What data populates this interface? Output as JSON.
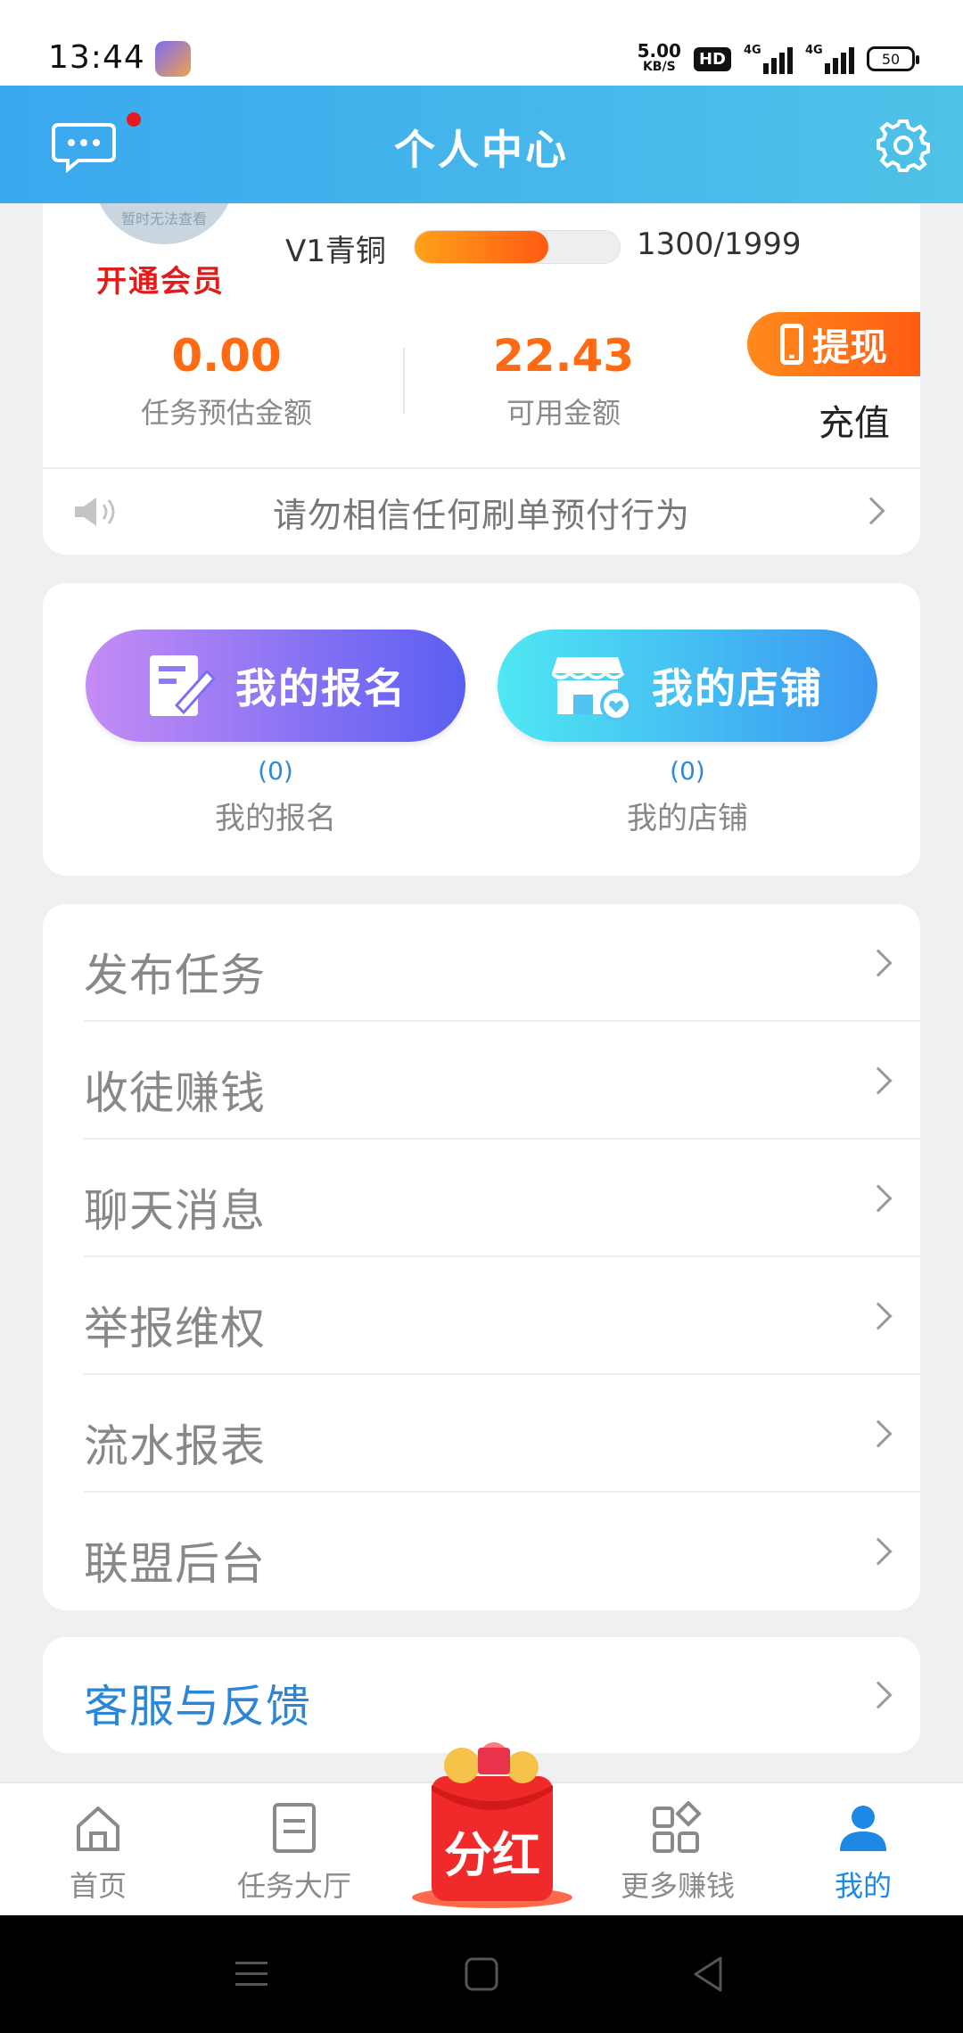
{
  "status_bar": {
    "time": "13:44",
    "net_speed": "5.00",
    "net_unit": "KB/S",
    "hd": "HD",
    "signal1": "4G",
    "signal2": "4G",
    "battery": "50"
  },
  "header": {
    "title": "个人中心"
  },
  "profile": {
    "avatar_text": "暂时无法查看",
    "vip_link": "开通会员",
    "level": "V1青铜",
    "level_progress": 0.65,
    "level_count": "1300/1999",
    "estimated_amount": "0.00",
    "estimated_label": "任务预估金额",
    "available_amount": "22.43",
    "available_label": "可用金额",
    "withdraw": "提现",
    "recharge": "充值",
    "notice": "请勿相信任何刷单预付行为"
  },
  "shortcuts": {
    "signup_button": "我的报名",
    "signup_count": "(0)",
    "signup_label": "我的报名",
    "shop_button": "我的店铺",
    "shop_count": "(0)",
    "shop_label": "我的店铺"
  },
  "menu": [
    {
      "label": "发布任务"
    },
    {
      "label": "收徒赚钱"
    },
    {
      "label": "聊天消息"
    },
    {
      "label": "举报维权"
    },
    {
      "label": "流水报表"
    },
    {
      "label": "联盟后台"
    }
  ],
  "service": {
    "label": "客服与反馈"
  },
  "bottom_nav": {
    "home": "首页",
    "tasks": "任务大厅",
    "dividend": "分红",
    "more": "更多赚钱",
    "mine": "我的"
  },
  "colors": {
    "header_start": "#3aa8ee",
    "header_end": "#4fc2e8",
    "amount": "#ff6a12",
    "vip": "#e21b1b",
    "active_nav": "#1e88e5"
  }
}
